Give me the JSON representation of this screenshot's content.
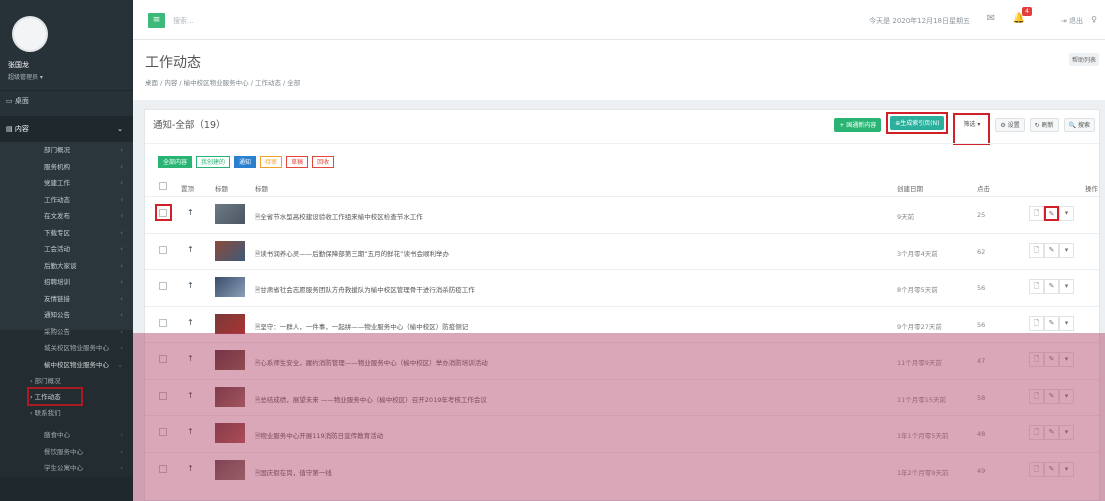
{
  "chart_data": {
    "type": "table",
    "title": "通知-全部（19）",
    "columns": [
      "置顶",
      "标题",
      "创建日期",
      "点击",
      "操作"
    ],
    "rows": [
      {
        "title": "全省节水型高校建设验收工作组来榆中校区检查节水工作",
        "date": "9天前",
        "hits": 25
      },
      {
        "title": "读书润养心灵——后勤保障部第三期“五月的鲜花”读书会顺利举办",
        "date": "3个月零4天前",
        "hits": 62
      },
      {
        "title": "甘肃省社会志愿服务团队方舟救援队为榆中校区管理骨干进行消杀防疫工作",
        "date": "8个月零5天前",
        "hits": 56
      },
      {
        "title": "坚守：一群人，一件事，一起拼——物业服务中心（榆中校区）防疫侧记",
        "date": "9个月零27天前",
        "hits": 56
      },
      {
        "title": "心系师生安全，履约消防管理——物业服务中心（榆中校区）举办消防培训活动",
        "date": "11个月零9天前",
        "hits": 47
      },
      {
        "title": "总结成绩，展望未来 ——物业服务中心（榆中校区）召开2019年考核工作会议",
        "date": "11个月零15天前",
        "hits": 58
      },
      {
        "title": "物业服务中心开展119消防日宣传教育活动",
        "date": "1年1个月零5天前",
        "hits": 48
      },
      {
        "title": "国庆假在岗，值守第一线",
        "date": "1年2个月零9天前",
        "hits": 49
      }
    ]
  },
  "app": {
    "search_placeholder": "搜索...",
    "date_text": "今天是 2020年12月18日星期五",
    "notif_count": "4",
    "logout_label": "退出"
  },
  "sidebar": {
    "user_name": "张国龙",
    "user_role": "超级管理员 ▾",
    "top_item": "▭ 桌面",
    "section_label": "▤ 内容",
    "items": [
      "部门概况",
      "服务机构",
      "党建工作",
      "工作动态",
      "在文发布",
      "下载专区",
      "工会活动",
      "后勤大家谈",
      "招聘培训",
      "友情链接",
      "通知公告",
      "采购公告",
      "城关校区物业服务中心",
      "榆中校区物业服务中心"
    ],
    "sub_items": [
      "› 部门概况",
      "› 工作动态",
      "› 联系我们"
    ],
    "bottom_items": [
      "膳食中心",
      "餐饮服务中心",
      "学生公寓中心"
    ]
  },
  "page": {
    "title": "工作动态",
    "breadcrumb": "桌面 / 内容 / 榆中校区物业服务中心 / 工作动态 / 全部",
    "help_label": "帮助列表"
  },
  "toolbar": {
    "new_label": "+ 国通新内容",
    "generate_label": "⊕生成索引页(N)",
    "filter_label": "筛选 ▾",
    "settings_label": "⚙ 设置",
    "refresh_label": "↻ 刷新",
    "search_label": "🔍 搜索"
  },
  "filters": [
    "全部内容",
    "我创建的",
    "通知",
    "待审",
    "草稿",
    "回收"
  ],
  "table_head": {
    "pin": "置顶",
    "thumb": "标题",
    "title": "标题",
    "date": "创建日期",
    "hits": "点击",
    "ops": "操作"
  }
}
